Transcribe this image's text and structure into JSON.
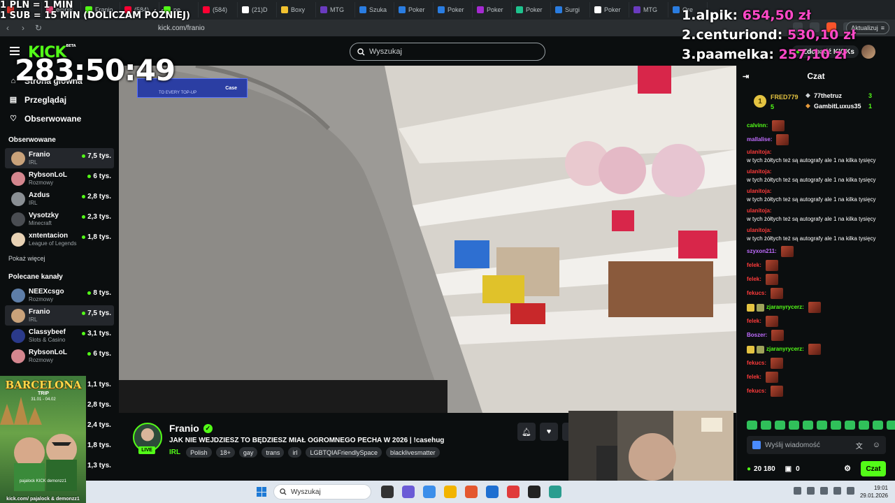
{
  "overlay": {
    "rules": [
      "1 PLN = 1 MIN",
      "1 SUB = 15 MIN (DOLICZAM PÓŹNIEJ)"
    ],
    "timer": "283:50:49",
    "leaderboard": [
      {
        "rank_name": "1.alpik:",
        "amount": "654,50 zł"
      },
      {
        "rank_name": "2.centuriond:",
        "amount": "530,10 zł"
      },
      {
        "rank_name": "3.paamelka:",
        "amount": "257,10 zł"
      }
    ]
  },
  "browser": {
    "tabs": [
      {
        "label": "",
        "color": "#d9342b"
      },
      {
        "label": "empik",
        "color": "#e64b7a"
      },
      {
        "label": "Franio",
        "color": "#53fc18"
      },
      {
        "label": "(584)",
        "color": "#ff0033"
      },
      {
        "label": "pe",
        "color": "#53fc18"
      },
      {
        "label": "(584)",
        "color": "#ff0033"
      },
      {
        "label": "(21)D",
        "color": "#ffffff"
      },
      {
        "label": "Boxy",
        "color": "#f2c230"
      },
      {
        "label": "MTG",
        "color": "#6a3bbf"
      },
      {
        "label": "Szuka",
        "color": "#2a7de1"
      },
      {
        "label": "Poker",
        "color": "#2a7de1"
      },
      {
        "label": "Poker",
        "color": "#2a7de1"
      },
      {
        "label": "Poker",
        "color": "#a52ad1"
      },
      {
        "label": "Poker",
        "color": "#1ec38e"
      },
      {
        "label": "Surgi",
        "color": "#2a7de1"
      },
      {
        "label": "Poker",
        "color": "#ffffff"
      },
      {
        "label": "MTG",
        "color": "#6a3bbf"
      },
      {
        "label": "Ore",
        "color": "#2a7de1"
      }
    ],
    "url": "kick.com/franio",
    "update_label": "Aktualizuj"
  },
  "header": {
    "logo": "KICK",
    "logo_beta": "BETA",
    "search_placeholder": "Wyszukaj",
    "kicks_label": "Zdobądź KICKs"
  },
  "sidebar": {
    "nav": [
      {
        "label": "Strona główna",
        "icon": "home-icon",
        "glyph": "⌂"
      },
      {
        "label": "Przeglądaj",
        "icon": "browse-icon",
        "glyph": "▤"
      },
      {
        "label": "Obserwowane",
        "icon": "heart-icon",
        "glyph": "♡"
      }
    ],
    "followed_title": "Obserwowane",
    "followed": [
      {
        "name": "Franio",
        "category": "IRL",
        "viewers": "7,5 tys.",
        "color": "#c9a27a",
        "active": true
      },
      {
        "name": "RybsonLoL",
        "category": "Rozmowy",
        "viewers": "6 tys.",
        "color": "#d4868e",
        "active": false
      },
      {
        "name": "Azdus",
        "category": "IRL",
        "viewers": "2,8 tys.",
        "color": "#8a8f94",
        "active": false
      },
      {
        "name": "Vysotzky",
        "category": "Minecraft",
        "viewers": "2,3 tys.",
        "color": "#4a4d52",
        "active": false
      },
      {
        "name": "xntentacion",
        "category": "League of Legends",
        "viewers": "1,8 tys.",
        "color": "#e8d2b4",
        "active": false
      }
    ],
    "show_more": "Pokaż więcej",
    "recommended_title": "Polecane kanały",
    "recommended": [
      {
        "name": "NEEXcsgo",
        "category": "Rozmowy",
        "viewers": "8 tys.",
        "color": "#5e7ea8",
        "active": false
      },
      {
        "name": "Franio",
        "category": "IRL",
        "viewers": "7,5 tys.",
        "color": "#c9a27a",
        "active": true
      },
      {
        "name": "Classybeef",
        "category": "Slots & Casino",
        "viewers": "3,1 tys.",
        "color": "#2b3a8a",
        "active": false
      },
      {
        "name": "RybsonLoL",
        "category": "Rozmowy",
        "viewers": "6 tys.",
        "color": "#d4868e",
        "active": false
      }
    ],
    "hidden_counts": [
      "1,1 tys.",
      "2,8 tys.",
      "2,4 tys.",
      "1,8 tys.",
      "1,3 tys."
    ]
  },
  "promo": {
    "title": "BARCELONA",
    "subtitle": "TRIP",
    "dates": "31.01 - 04.02",
    "names": "pajalock  KICK  demonzz1",
    "footer": "kick.com/ pajalock & demonzz1"
  },
  "stream": {
    "streamer": "Franio",
    "live": "LIVE",
    "title": "JAK NIE WEJDZIESZ TO BĘDZIESZ MIAŁ OGROMNEGO PECHA W 2026 | !casehug",
    "category": "IRL",
    "tags": [
      "Polish",
      "18+",
      "gay",
      "trans",
      "irl",
      "LGBTQIAFriendlySpace",
      "blacklivesmatter"
    ],
    "banner_brand": "Case",
    "banner_text": "TO EVERY TOP-UP"
  },
  "chat": {
    "title": "Czat",
    "gifters": [
      {
        "rank": "1",
        "name": "FRED779",
        "count": "5"
      },
      {
        "name": "77thetruz",
        "count": "3"
      },
      {
        "name": "GambitLuxus35",
        "count": "1"
      }
    ],
    "messages": [
      {
        "user": "calvinn:",
        "color": "#53fc18",
        "text": "",
        "emote": true,
        "badges": false
      },
      {
        "user": "mallalise:",
        "color": "#c06cff",
        "text": "",
        "emote": true,
        "badges": false
      },
      {
        "user": "ulanitoja:",
        "color": "#ff3b3b",
        "text": "w tych żółtych też są autografy ale 1 na kilka tysięcy",
        "emote": false,
        "badges": false
      },
      {
        "user": "ulanitoja:",
        "color": "#ff3b3b",
        "text": "w tych żółtych też są autografy ale 1 na kilka tysięcy",
        "emote": false,
        "badges": false
      },
      {
        "user": "ulanitoja:",
        "color": "#ff3b3b",
        "text": "w tych żółtych też są autografy ale 1 na kilka tysięcy",
        "emote": false,
        "badges": false
      },
      {
        "user": "ulanitoja:",
        "color": "#ff3b3b",
        "text": "w tych żółtych też są autografy ale 1 na kilka tysięcy",
        "emote": false,
        "badges": false
      },
      {
        "user": "ulanitoja:",
        "color": "#ff3b3b",
        "text": "w tych żółtych też są autografy ale 1 na kilka tysięcy",
        "emote": false,
        "badges": false
      },
      {
        "user": "szyxon211:",
        "color": "#c06cff",
        "text": "",
        "emote": true,
        "badges": false
      },
      {
        "user": "felek:",
        "color": "#ff3b3b",
        "text": "",
        "emote": true,
        "badges": false
      },
      {
        "user": "felek:",
        "color": "#ff3b3b",
        "text": "",
        "emote": true,
        "badges": false
      },
      {
        "user": "fekucs:",
        "color": "#ff3b3b",
        "text": "",
        "emote": true,
        "badges": false
      },
      {
        "user": "zjaranyrycerz:",
        "color": "#53fc18",
        "text": "",
        "emote": true,
        "badges": true
      },
      {
        "user": "felek:",
        "color": "#ff3b3b",
        "text": "",
        "emote": true,
        "badges": false
      },
      {
        "user": "Boszer:",
        "color": "#c06cff",
        "text": "",
        "emote": true,
        "badges": false
      },
      {
        "user": "zjaranyrycerz:",
        "color": "#53fc18",
        "text": "",
        "emote": true,
        "badges": true
      },
      {
        "user": "fekucs:",
        "color": "#ff3b3b",
        "text": "",
        "emote": true,
        "badges": false
      },
      {
        "user": "felek:",
        "color": "#ff3b3b",
        "text": "",
        "emote": true,
        "badges": false
      },
      {
        "user": "fekucs:",
        "color": "#ff3b3b",
        "text": "",
        "emote": true,
        "badges": false
      }
    ],
    "input_placeholder": "Wyślij wiadomość",
    "points": "20 180",
    "drops": "0",
    "send_label": "Czat"
  },
  "taskbar": {
    "search_placeholder": "Wyszukaj",
    "time": "19:01",
    "date": "29.01.2026"
  }
}
